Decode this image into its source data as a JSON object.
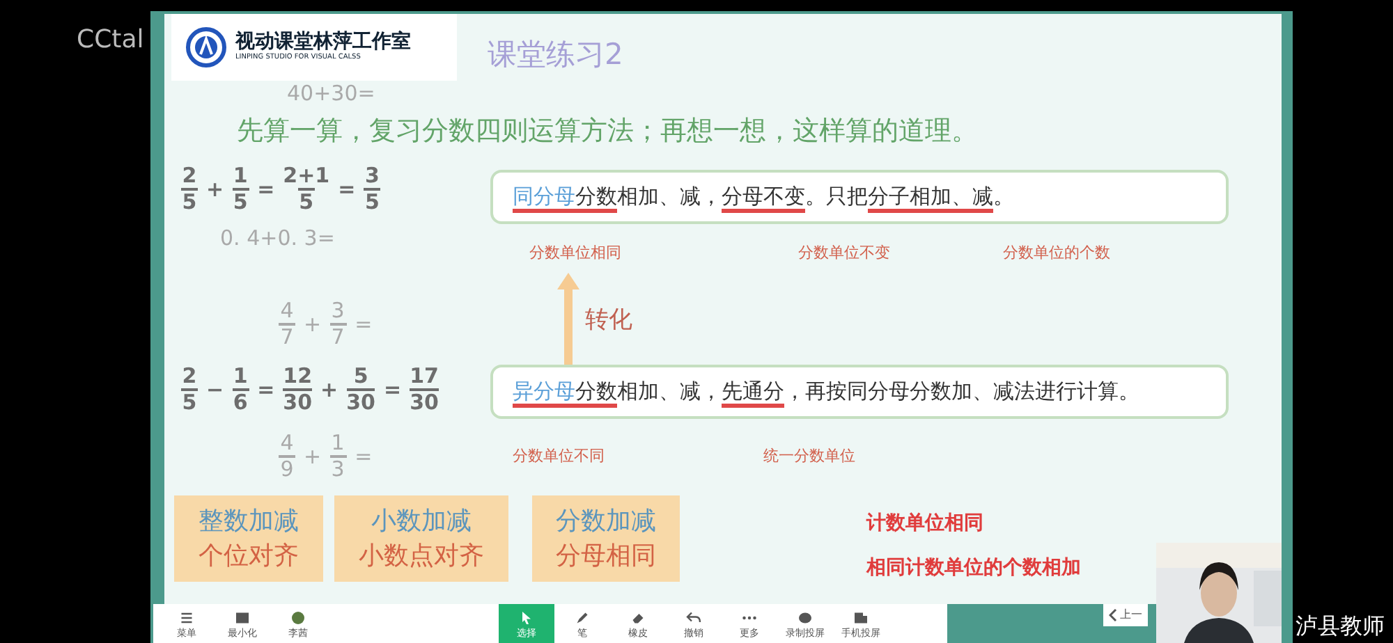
{
  "app_logo": "CCtal",
  "slide": {
    "studio": {
      "name": "视动课堂林萍工作室",
      "subtitle": "LINPING STUDIO FOR VISUAL CALSS"
    },
    "title": "课堂练习2",
    "instruction": "先算一算，复习分数四则运算方法；再想一想，这样算的道理。",
    "equations": [
      {
        "tokens": [
          {
            "kind": "frac",
            "num": "2",
            "den": "5"
          },
          {
            "kind": "op",
            "text": "+"
          },
          {
            "kind": "frac",
            "num": "1",
            "den": "5"
          },
          {
            "kind": "op",
            "text": "="
          },
          {
            "kind": "frac",
            "num": "2+1",
            "den": "5"
          },
          {
            "kind": "op",
            "text": "="
          },
          {
            "kind": "frac",
            "num": "3",
            "den": "5"
          }
        ]
      },
      {
        "tokens": [
          {
            "kind": "frac",
            "num": "2",
            "den": "5"
          },
          {
            "kind": "op",
            "text": "−"
          },
          {
            "kind": "frac",
            "num": "1",
            "den": "6"
          },
          {
            "kind": "op",
            "text": "="
          },
          {
            "kind": "frac",
            "num": "12",
            "den": "30"
          },
          {
            "kind": "op",
            "text": "+"
          },
          {
            "kind": "frac",
            "num": "5",
            "den": "30"
          },
          {
            "kind": "op",
            "text": "="
          },
          {
            "kind": "frac",
            "num": "17",
            "den": "30"
          }
        ]
      }
    ],
    "exercises": [
      {
        "tokens": [
          {
            "kind": "op",
            "text": "40+30="
          }
        ]
      },
      {
        "tokens": [
          {
            "kind": "op",
            "text": "0. 4+0. 3="
          }
        ]
      },
      {
        "tokens": [
          {
            "kind": "frac",
            "num": "4",
            "den": "7"
          },
          {
            "kind": "op",
            "text": "+"
          },
          {
            "kind": "frac",
            "num": "3",
            "den": "7"
          },
          {
            "kind": "op",
            "text": "="
          }
        ]
      },
      {
        "tokens": [
          {
            "kind": "frac",
            "num": "4",
            "den": "9"
          },
          {
            "kind": "op",
            "text": "+"
          },
          {
            "kind": "frac",
            "num": "1",
            "den": "3"
          },
          {
            "kind": "op",
            "text": "="
          }
        ]
      }
    ],
    "rules": [
      {
        "segments": [
          {
            "text": "同分母",
            "kind": "key",
            "underline": true
          },
          {
            "text": "分数",
            "kind": "plain",
            "underline": true
          },
          {
            "text": "相加、减，",
            "kind": "plain",
            "underline": false
          },
          {
            "text": "分母不变",
            "kind": "plain",
            "underline": true
          },
          {
            "text": "。只把",
            "kind": "plain",
            "underline": false
          },
          {
            "text": "分子相加、减",
            "kind": "plain",
            "underline": true
          },
          {
            "text": "。",
            "kind": "plain",
            "underline": false
          }
        ],
        "notes": [
          "分数单位相同",
          "分数单位不变",
          "分数单位的个数"
        ]
      },
      {
        "segments": [
          {
            "text": "异分母",
            "kind": "key",
            "underline": true
          },
          {
            "text": "分数",
            "kind": "plain",
            "underline": true
          },
          {
            "text": "相加、减，",
            "kind": "plain",
            "underline": false
          },
          {
            "text": "先通分",
            "kind": "plain",
            "underline": true
          },
          {
            "text": "，再按同分母分数加、减法进行计算。",
            "kind": "plain",
            "underline": false
          }
        ],
        "notes": [
          "分数单位不同",
          "统一分数单位"
        ]
      }
    ],
    "arrow_label": "转化",
    "cards": [
      {
        "title": "整数加减",
        "rule": "个位对齐"
      },
      {
        "title": "小数加减",
        "rule": "小数点对齐"
      },
      {
        "title": "分数加减",
        "rule": "分母相同"
      }
    ],
    "summary": [
      "计数单位相同",
      "相同计数单位的个数相加"
    ]
  },
  "toolbar": [
    {
      "label": "菜单",
      "selected": false
    },
    {
      "label": "最小化",
      "selected": false
    },
    {
      "label": "李茜",
      "selected": false
    },
    {
      "label": "选择",
      "selected": true
    },
    {
      "label": "笔",
      "selected": false
    },
    {
      "label": "橡皮",
      "selected": false
    },
    {
      "label": "撤销",
      "selected": false
    },
    {
      "label": "更多",
      "selected": false
    },
    {
      "label": "录制投屏",
      "selected": false
    },
    {
      "label": "手机投屏",
      "selected": false
    }
  ],
  "prev_button": "上一",
  "teacher_label": "泸县教师"
}
